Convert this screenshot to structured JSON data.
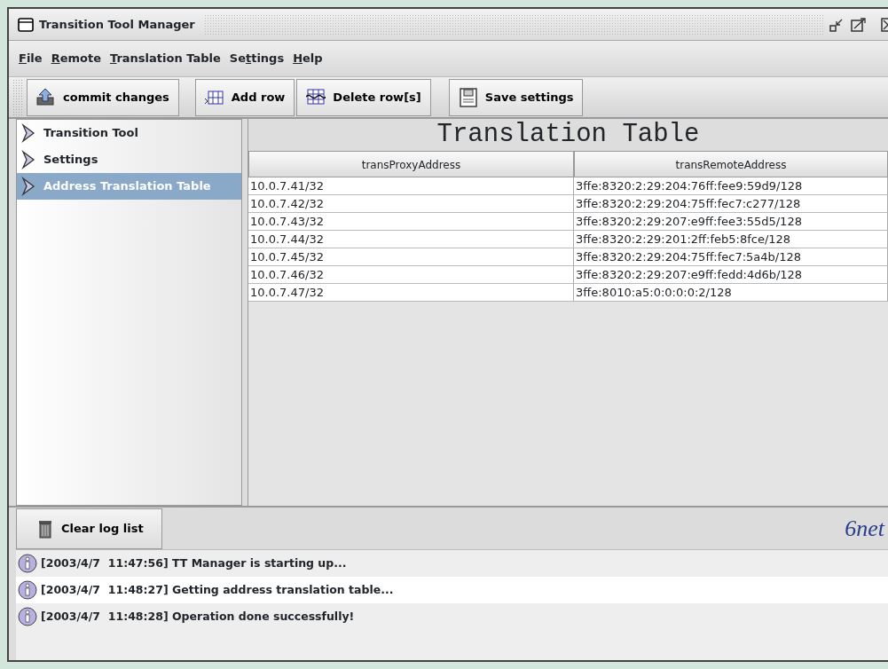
{
  "window": {
    "title": "Transition Tool Manager"
  },
  "menu": [
    {
      "key": "F",
      "after": "ile"
    },
    {
      "key": "R",
      "after": "emote"
    },
    {
      "key": "T",
      "after": "ranslation Table"
    },
    {
      "before": "Se",
      "key": "t",
      "after": "tings"
    },
    {
      "key": "H",
      "after": "elp"
    }
  ],
  "toolbar": [
    {
      "label": "commit changes",
      "kind": "commit"
    },
    {
      "label": "Add row",
      "kind": "add"
    },
    {
      "label": "Delete row[s]",
      "kind": "delete"
    },
    {
      "label": "Save settings",
      "kind": "save"
    }
  ],
  "sidebar": {
    "items": [
      {
        "label": "Transition Tool",
        "selected": false
      },
      {
        "label": "Settings",
        "selected": false
      },
      {
        "label": "Address Translation Table",
        "selected": true
      }
    ]
  },
  "table": {
    "title": "Translation Table",
    "columns": [
      "transProxyAddress",
      "transRemoteAddress"
    ],
    "rows": [
      [
        "10.0.7.41/32",
        "3ffe:8320:2:29:204:76ff:fee9:59d9/128"
      ],
      [
        "10.0.7.42/32",
        "3ffe:8320:2:29:204:75ff:fec7:c277/128"
      ],
      [
        "10.0.7.43/32",
        "3ffe:8320:2:29:207:e9ff:fee3:55d5/128"
      ],
      [
        "10.0.7.44/32",
        "3ffe:8320:2:29:201:2ff:feb5:8fce/128"
      ],
      [
        "10.0.7.45/32",
        "3ffe:8320:2:29:204:75ff:fec7:5a4b/128"
      ],
      [
        "10.0.7.46/32",
        "3ffe:8320:2:29:207:e9ff:fedd:4d6b/128"
      ],
      [
        "10.0.7.47/32",
        "3ffe:8010:a5:0:0:0:0:2/128"
      ]
    ]
  },
  "log": {
    "button": "Clear log list",
    "logo": "6net",
    "entries": [
      "[2003/4/7  11:47:56] TT Manager is starting up...",
      "[2003/4/7  11:48:27] Getting address translation table...",
      "[2003/4/7  11:48:28] Operation done successfully!"
    ]
  }
}
